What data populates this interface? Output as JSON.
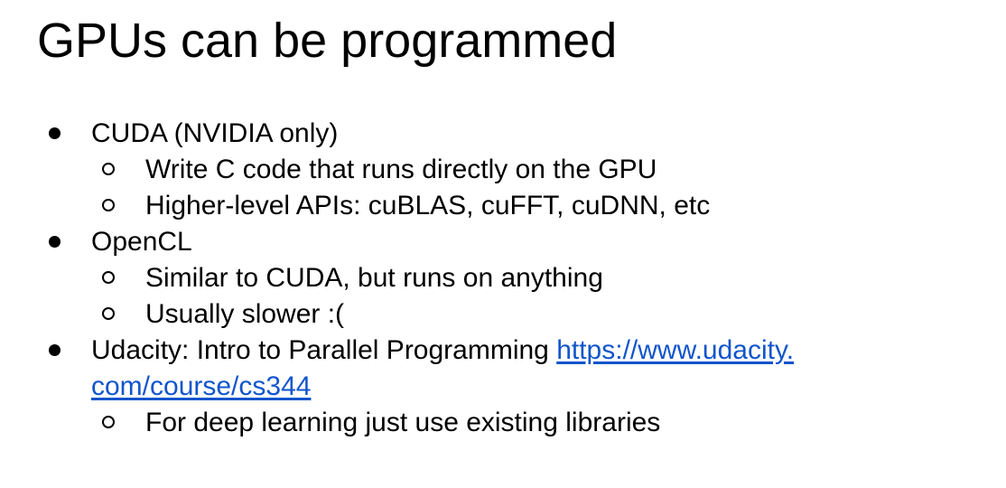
{
  "slide": {
    "title": "GPUs can be programmed",
    "bullets": [
      {
        "text": "CUDA (NVIDIA only)",
        "children": [
          "Write C code that runs directly on the GPU",
          "Higher-level APIs: cuBLAS, cuFFT, cuDNN, etc"
        ]
      },
      {
        "text": "OpenCL",
        "children": [
          "Similar to CUDA, but runs on anything",
          "Usually slower :("
        ]
      },
      {
        "text": "Udacity: Intro to Parallel Programming ",
        "link_line1": "https://www.udacity.",
        "link_line2": "com/course/cs344",
        "children": [
          "For deep learning just use existing libraries"
        ]
      }
    ]
  },
  "colors": {
    "link": "#1155cc",
    "text": "#000000",
    "background": "#ffffff"
  }
}
